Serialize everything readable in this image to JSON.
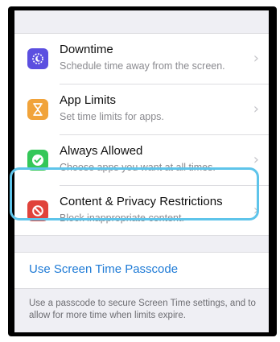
{
  "settings": {
    "rows": [
      {
        "title": "Downtime",
        "subtitle": "Schedule time away from the screen.",
        "icon": "moon-icon",
        "color": "#5b4fe0"
      },
      {
        "title": "App Limits",
        "subtitle": "Set time limits for apps.",
        "icon": "hourglass-icon",
        "color": "#f1a33a"
      },
      {
        "title": "Always Allowed",
        "subtitle": "Choose apps you want at all times.",
        "icon": "checkmark-badge-icon",
        "color": "#34c759"
      },
      {
        "title": "Content & Privacy Restrictions",
        "subtitle": "Block inappropriate content.",
        "icon": "prohibited-icon",
        "color": "#e0433b"
      }
    ]
  },
  "passcode": {
    "label": "Use Screen Time Passcode",
    "footnote": "Use a passcode to secure Screen Time settings, and to allow for more time when limits expire."
  },
  "colors": {
    "highlight": "#5ec4ea",
    "link": "#1f7bd6"
  }
}
